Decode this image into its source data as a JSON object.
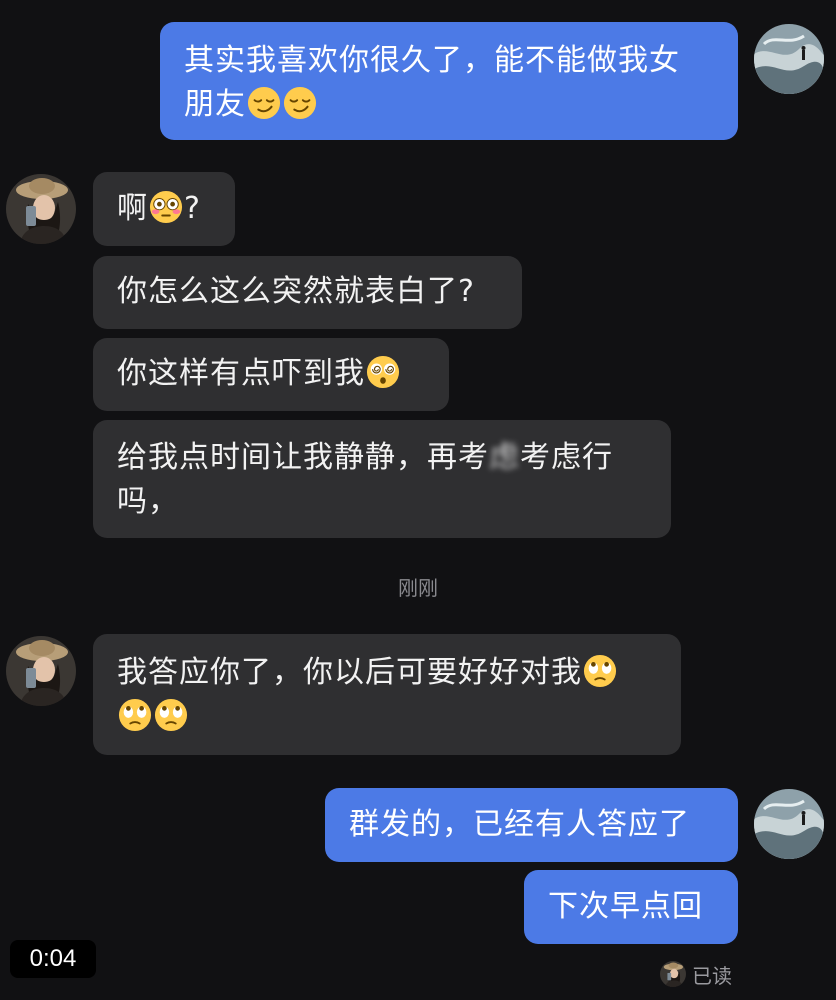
{
  "messages": [
    {
      "id": "m1",
      "side": "sent",
      "text_parts": [
        "其实我喜欢你很久了，能不能做我女",
        "朋友"
      ],
      "emoji": [
        "smirk",
        "smirk"
      ]
    },
    {
      "id": "m2",
      "side": "recv",
      "text_before": "啊",
      "emoji": "flushed",
      "text_after": "?"
    },
    {
      "id": "m3",
      "side": "recv",
      "text": "你怎么这么突然就表白了?"
    },
    {
      "id": "m4",
      "side": "recv",
      "text": "你这样有点吓到我",
      "emoji": "dizzy"
    },
    {
      "id": "m5",
      "side": "recv",
      "line1_a": "给我点时间让我静静，再考",
      "line1_blur": "虑",
      "line1_b": "考虑行",
      "line2": "吗，"
    },
    {
      "id": "m6",
      "side": "recv",
      "line1": "我答应你了，你以后可要好好对我",
      "emoji": [
        "eyeroll",
        "eyeroll",
        "eyeroll"
      ]
    },
    {
      "id": "m7",
      "side": "sent",
      "text": "群发的，已经有人答应了"
    },
    {
      "id": "m8",
      "side": "sent",
      "text": "下次早点回"
    }
  ],
  "timestamp_divider": "刚刚",
  "read_receipt": "已读",
  "video_duration": "0:04",
  "colors": {
    "background": "#111113",
    "sent_bubble": "#4c7ae6",
    "recv_bubble": "#2f2f31",
    "timestamp": "#8a8a8f"
  },
  "icons": {
    "self_avatar": "ocean-wave-avatar",
    "contact_avatar": "woman-hat-avatar",
    "emoji_smirk": "smirk-emoji",
    "emoji_flushed": "flushed-emoji",
    "emoji_dizzy": "dizzy-eyes-emoji",
    "emoji_eyeroll": "eye-roll-emoji"
  }
}
